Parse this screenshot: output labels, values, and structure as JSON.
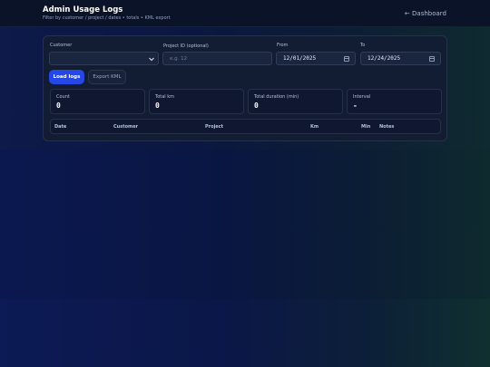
{
  "header": {
    "title": "Admin Usage Logs",
    "subtitle": "Filter by customer / project / dates • totals • KML export",
    "dashboard_link": "← Dashboard"
  },
  "filters": {
    "customer_label": "Customer",
    "customer_value": "",
    "project_label": "Project ID (optional)",
    "project_placeholder": "e.g. 12",
    "from_label": "From",
    "from_value": "12/01/2025",
    "to_label": "To",
    "to_value": "12/24/2025"
  },
  "actions": {
    "load_label": "Load logs",
    "export_label": "Export KML"
  },
  "stats": [
    {
      "label": "Count",
      "value": "0"
    },
    {
      "label": "Total km",
      "value": "0"
    },
    {
      "label": "Total duration (min)",
      "value": "0"
    },
    {
      "label": "Interval",
      "value": "-"
    }
  ],
  "table": {
    "columns": [
      "Date",
      "Customer",
      "Project",
      "Km",
      "Min",
      "Notes"
    ],
    "rows": []
  },
  "colors": {
    "accent": "#2447e6",
    "background": "#0a1433",
    "card": "#121c33"
  }
}
